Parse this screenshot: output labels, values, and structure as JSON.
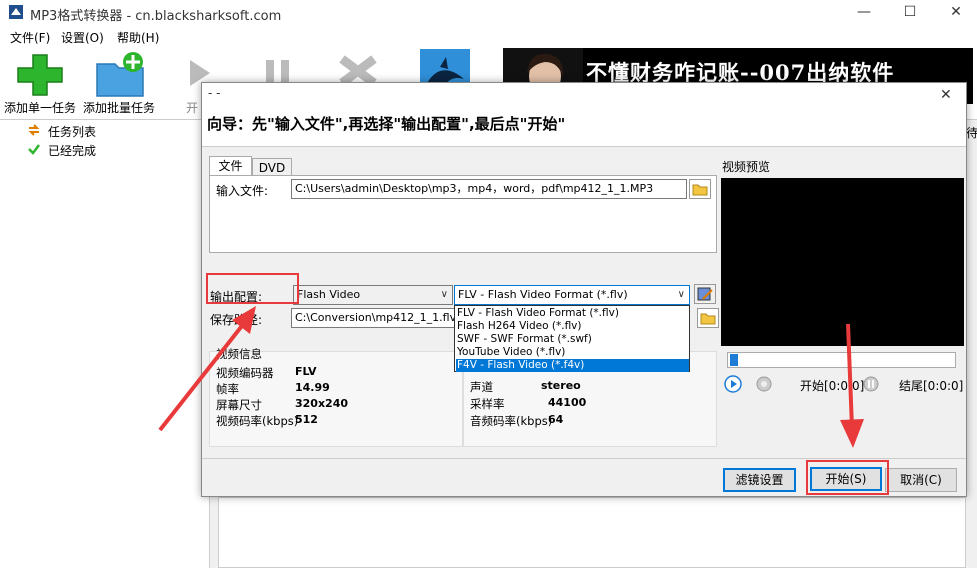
{
  "window": {
    "title": "MP3格式转换器 - cn.blacksharksoft.com",
    "minimize": "—",
    "maximize": "☐",
    "close": "✕"
  },
  "menu": {
    "items": [
      "文件(F)",
      "设置(O)",
      "帮助(H)"
    ]
  },
  "toolbar": {
    "add_single": "添加单一任务",
    "add_batch": "添加批量任务",
    "start_partial": "开"
  },
  "banner": {
    "text": "不懂财务咋记账--007出纳软件"
  },
  "tree": {
    "items": [
      "任务列表",
      "已经完成"
    ]
  },
  "right_edge_text": "待",
  "dialog": {
    "title": "- -",
    "close": "✕",
    "wizard": "向导：先\"输入文件\",再选择\"输出配置\",最后点\"开始\"",
    "tabs": [
      "文件",
      "DVD"
    ],
    "input_label": "输入文件:",
    "input_value": "C:\\Users\\admin\\Desktop\\mp3，mp4，word，pdf\\mp412_1_1.MP3",
    "output_config_label": "输出配置:",
    "output_category": "Flash Video",
    "output_format": "FLV - Flash Video Format (*.flv)",
    "save_label": "保存路径:",
    "save_value": "C:\\Conversion\\mp412_1_1.flv",
    "dropdown_options": [
      "FLV - Flash Video Format (*.flv)",
      "Flash H264 Video (*.flv)",
      "SWF - SWF Format (*.swf)",
      "YouTube Video (*.flv)",
      "F4V - Flash Video (*.f4v)"
    ],
    "dropdown_selected_index": 4,
    "video_info": {
      "heading": "视频信息",
      "rows": [
        {
          "label": "视频编码器",
          "value": "FLV"
        },
        {
          "label": "帧率",
          "value": "14.99"
        },
        {
          "label": "屏幕尺寸",
          "value": "320x240"
        },
        {
          "label": "视频码率(kbps)",
          "value": "512"
        }
      ]
    },
    "audio_info": {
      "rows": [
        {
          "label": "声道",
          "value": "stereo"
        },
        {
          "label": "采样率",
          "value": "44100"
        },
        {
          "label": "音频码率(kbps)",
          "value": "64"
        }
      ]
    },
    "preview_label": "视频预览",
    "start_point": "开始[0:0:0]",
    "end_point": "结尾[0:0:0]",
    "filter_button": "滤镜设置",
    "start_button": "开始(S)",
    "cancel_button": "取消(C)"
  },
  "colors": {
    "accent": "#0078d7",
    "annotation_red": "#e83a3a",
    "green_icon": "#2db52d",
    "folder_blue": "#4aa3e0"
  }
}
